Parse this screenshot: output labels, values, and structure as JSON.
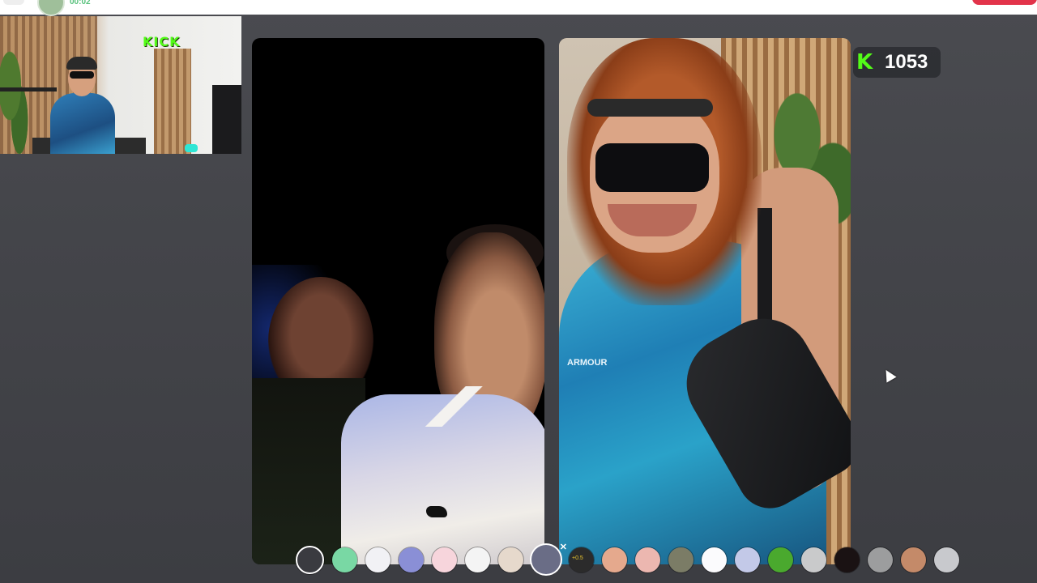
{
  "top_bar": {
    "timer": "00:02"
  },
  "webcam": {
    "logo_text": "KICK"
  },
  "viewer_badge": {
    "icon": "kick-k-icon",
    "count": "1053",
    "brand_color": "#53fc18"
  },
  "right_tile": {
    "shirt_text": "ARMOUR"
  },
  "filters": [
    {
      "name": "none",
      "color": "#3a3b40"
    },
    {
      "name": "green-face",
      "color": "#79d8a4"
    },
    {
      "name": "stars",
      "color": "#f1f1f5"
    },
    {
      "name": "blue-fish",
      "color": "#8a8fd6"
    },
    {
      "name": "blush-face",
      "color": "#f7d5dc"
    },
    {
      "name": "panda",
      "color": "#f4f4f4"
    },
    {
      "name": "mustache",
      "color": "#e6d9cc"
    },
    {
      "name": "hair-wig",
      "color": "#6a6d86",
      "selected": true
    },
    {
      "name": "speed",
      "color": "#2b2b2b",
      "label": "+0.5"
    },
    {
      "name": "orange-face",
      "color": "#e5a98d"
    },
    {
      "name": "pink-face",
      "color": "#ecb7b0"
    },
    {
      "name": "donkey",
      "color": "#7b7c66"
    },
    {
      "name": "white-face",
      "color": "#fbfbfd"
    },
    {
      "name": "robot",
      "color": "#c3c9e8"
    },
    {
      "name": "green-star",
      "color": "#4aa92e"
    },
    {
      "name": "sad-face",
      "color": "#c9cacb"
    },
    {
      "name": "devil",
      "color": "#1a1213"
    },
    {
      "name": "grey-face",
      "color": "#9c9d9e"
    },
    {
      "name": "real-face",
      "color": "#c48a69"
    },
    {
      "name": "blank-face",
      "color": "#c8c9cd"
    }
  ]
}
